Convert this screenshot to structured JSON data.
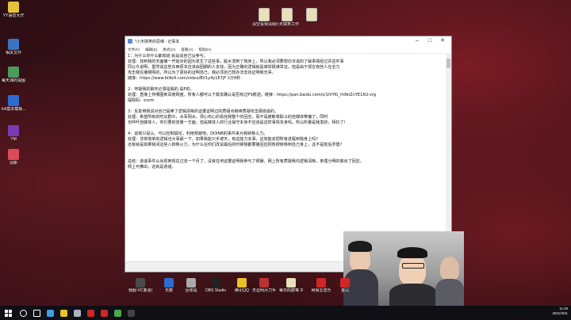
{
  "desktop": {
    "icons_left": [
      {
        "label": "YY语音大厅",
        "color": "#e6c23a"
      },
      {
        "label": "相关文件",
        "color": "#3a73c4"
      },
      {
        "label": "每天课的说图",
        "color": "#4a9c5a"
      },
      {
        "label": "lol/基本模板...",
        "color": "#2d6bd1"
      },
      {
        "label": "YM",
        "color": "#7a3ab8"
      },
      {
        "label": "清新",
        "color": "#d94a5a"
      }
    ],
    "icons_top": [
      {
        "label": "清空看我清除",
        "color": "#e7e0b8"
      },
      {
        "label": "小天搞笑工作...",
        "color": "#e7e0b8"
      },
      {
        "label": "",
        "color": "#e7e0b8"
      }
    ]
  },
  "notepad": {
    "title": "*小天搞笑的思维 - 记事本",
    "menu": [
      "文件(F)",
      "编辑(E)",
      "格式(O)",
      "查看(V)",
      "帮助(H)"
    ],
    "lines": [
      "1：为什么你什么都知道 就是说自己没参与。",
      "处理：找到我的天面播一开始对的因为发生了这些事，脏水泼到了我身上，所以我必须要想办法说的了解事情经过并这件事",
      "同公众说明，虽然说这些东西原本应该由团期的人去找，因为正确的逻辑就是谁举报谁举证，但是由于现在有些人在全力",
      "攻击我在播候网的，所以为了更好的证明自己，我必须自己想办法去找证明我无辜。",
      "链接：https://www.bilibili.com/video/BV1y4y1E7jF 1分6秒",
      "",
      "2：怀疑我的聊天记录是假的 是P的。",
      "处理：直接上传哪图到百度网盘，所有人都可以下载去确认是否有过PS痕迹。链接：https://pan.baidu.com/s/1lVYKi_rhNnZnYE1KU-vrg",
      "提取码：eszm",
      "",
      "3：反复用我说对自己提拳了逻辑清晰的证据证明过的质疑点继续质疑攻击硬造谣的。",
      "处理：希望所有的吃瓜群众，水军网水，烦心鸡心的看完我整个的回应，而不是被断章取义的自媒体带偏了，同时",
      "也呼吁自媒体人，你们要的流量一方面，但是媒体人的行业操守本身不应该是这样事情本身吗。所以所量是我发的，拜托了!",
      "",
      "4：说我只是认，可以控制舆论，利用规避地，DOINB的事件来为我转移火力。",
      "处理：非常简单的逻辑也大事最一下，如果我能只手遮天，有这能力本事，这效能去把所有进程到我身上吗?",
      "还有就是如果我间这些人转移火力，为什么在你们改说最后的时候我都要播回应把热搜转移到自己身上，这不是前后矛盾?",
      "",
      "",
      "总结：造谣事件从出现到现在过去一个月了，没有任何证据证明我参与了频播，网上所有质疑我均逻辑清晰，条理分明的做出了回应。",
      "     倾上可佛出，这就是造谣。"
    ],
    "status": "第 21 列"
  },
  "taskbar": {
    "apps": [
      {
        "label": "我服-VC要更新",
        "color": "#4a4a4a"
      },
      {
        "label": "无痕",
        "color": "#2d6bd1"
      },
      {
        "label": "回收站",
        "color": "#aaaaaa"
      },
      {
        "label": "OBS Studio",
        "color": "#222222"
      },
      {
        "label": "腾讯QQ",
        "color": "#e8c227"
      },
      {
        "label": "天涯明月刀手游",
        "color": "#b33"
      },
      {
        "label": "每日的群等 2021_3_13...",
        "color": "#e7e0b8"
      },
      {
        "label": "网易云音乐",
        "color": "#d02626"
      },
      {
        "label": "金山",
        "color": "#d02626"
      }
    ],
    "pinned": [
      {
        "name": "search-icon",
        "color": "#ffffff"
      },
      {
        "name": "task-view-icon",
        "color": "#ffffff"
      },
      {
        "name": "edge-icon",
        "color": "#3aa0e0"
      },
      {
        "name": "folder-icon",
        "color": "#e8c227"
      },
      {
        "name": "steam-icon",
        "color": "#aab3c2"
      },
      {
        "name": "red-app-icon",
        "color": "#d02626"
      },
      {
        "name": "netease-icon",
        "color": "#d02626"
      },
      {
        "name": "chrome-icon",
        "color": "#4ba84a"
      },
      {
        "name": "obs-icon",
        "color": "#444444"
      }
    ],
    "time": "11:29",
    "date": "2021/3/21"
  }
}
